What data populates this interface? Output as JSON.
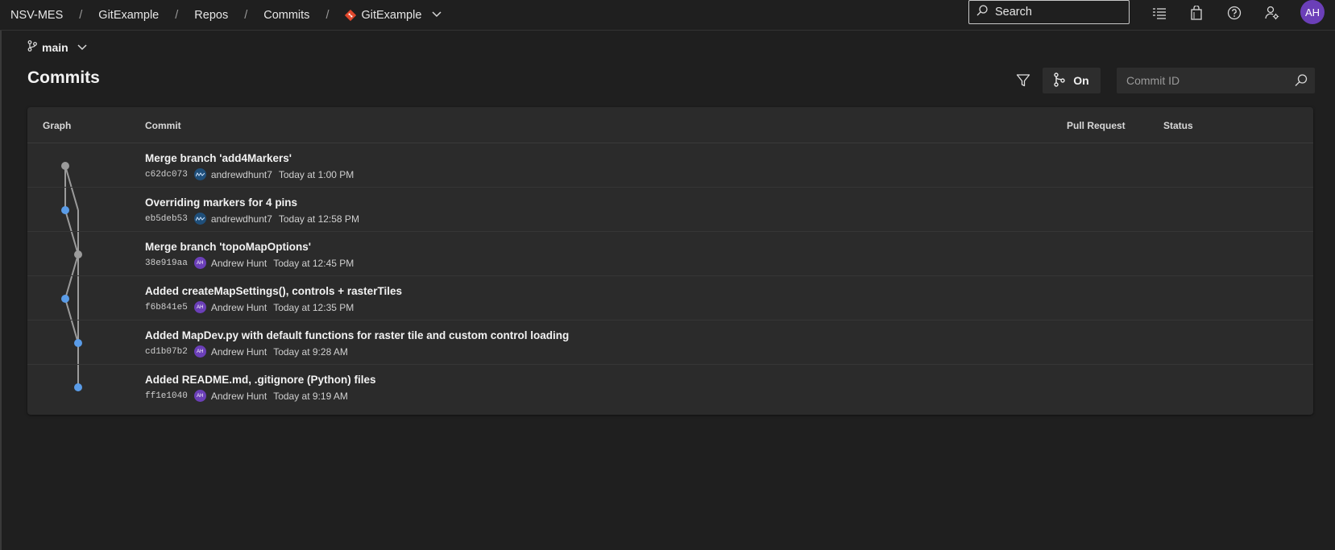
{
  "breadcrumbs": [
    "NSV-MES",
    "GitExample",
    "Repos",
    "Commits"
  ],
  "repo_name": "GitExample",
  "search": {
    "placeholder": "Search"
  },
  "user_initials": "AH",
  "branch": "main",
  "page_title": "Commits",
  "graph_toggle_label": "On",
  "commit_search": {
    "placeholder": "Commit ID"
  },
  "table": {
    "headers": {
      "graph": "Graph",
      "commit": "Commit",
      "pull_request": "Pull Request",
      "status": "Status"
    },
    "rows": [
      {
        "message": "Merge branch 'add4Markers'",
        "hash": "c62dc073",
        "author": "andrewdhunt7",
        "avatar": "blue",
        "avatar_text": "",
        "time": "Today at 1:00 PM"
      },
      {
        "message": "Overriding markers for 4 pins",
        "hash": "eb5deb53",
        "author": "andrewdhunt7",
        "avatar": "blue",
        "avatar_text": "",
        "time": "Today at 12:58 PM"
      },
      {
        "message": "Merge branch 'topoMapOptions'",
        "hash": "38e919aa",
        "author": "Andrew Hunt",
        "avatar": "purple",
        "avatar_text": "AH",
        "time": "Today at 12:45 PM"
      },
      {
        "message": "Added createMapSettings(), controls + rasterTiles",
        "hash": "f6b841e5",
        "author": "Andrew Hunt",
        "avatar": "purple",
        "avatar_text": "AH",
        "time": "Today at 12:35 PM"
      },
      {
        "message": "Added MapDev.py with default functions for raster tile and custom control loading",
        "hash": "cd1b07b2",
        "author": "Andrew Hunt",
        "avatar": "purple",
        "avatar_text": "AH",
        "time": "Today at 9:28 AM"
      },
      {
        "message": "Added README.md, .gitignore (Python) files",
        "hash": "ff1e1040",
        "author": "Andrew Hunt",
        "avatar": "purple",
        "avatar_text": "AH",
        "time": "Today at 9:19 AM"
      }
    ]
  },
  "colors": {
    "background": "#1f1f1f",
    "card": "#2b2b2b",
    "commit_dot_blue": "#5a9ce8",
    "commit_dot_gray": "#9b9b9b",
    "graph_line": "#9b9b9b",
    "avatar_purple": "#6b3fb8",
    "git_icon": "#e0482d"
  },
  "icons": [
    "search-icon",
    "task-list-icon",
    "shopping-bag-icon",
    "help-icon",
    "user-settings-icon",
    "branch-icon",
    "chevron-down-icon",
    "filter-icon",
    "graph-icon",
    "git-repo-icon"
  ]
}
